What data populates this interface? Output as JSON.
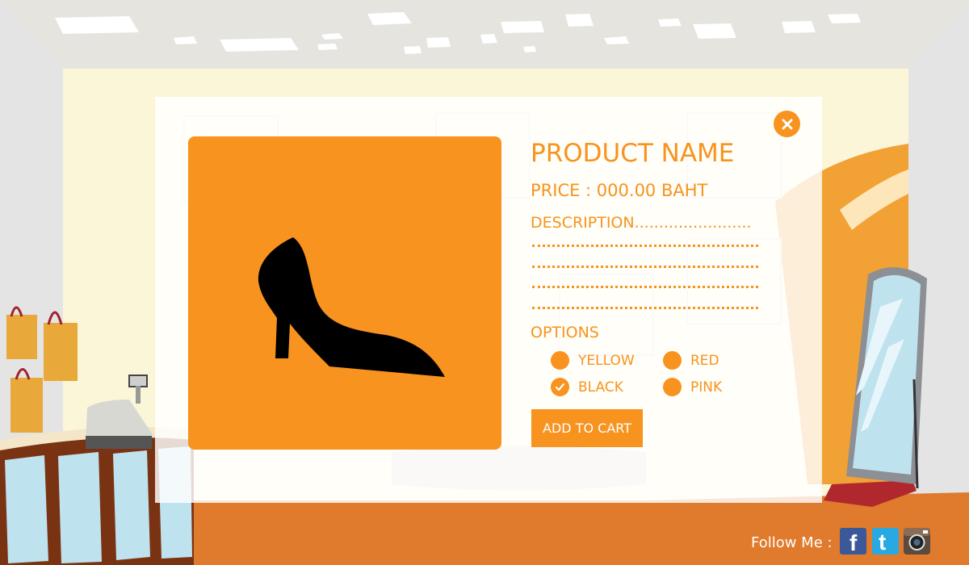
{
  "product": {
    "name": "PRODUCT NAME",
    "price": "PRICE :  000.00 BAHT",
    "description_label": "DESCRIPTION........................",
    "image_icon": "high-heel-shoe-icon"
  },
  "options": {
    "label": "OPTIONS",
    "items": [
      {
        "label": "YELLOW",
        "checked": false
      },
      {
        "label": "RED",
        "checked": false
      },
      {
        "label": "BLACK",
        "checked": true
      },
      {
        "label": "PINK",
        "checked": false
      }
    ]
  },
  "add_to_cart_label": "ADD TO CART",
  "close_icon": "close-icon",
  "footer": {
    "follow_label": "Follow Me :",
    "social": [
      {
        "name": "facebook-icon",
        "color": "#3b5998",
        "glyph": "f"
      },
      {
        "name": "twitter-icon",
        "color": "#29a9e1",
        "glyph": "t"
      },
      {
        "name": "instagram-icon",
        "color": "#5b4a3f",
        "glyph": ""
      }
    ]
  },
  "colors": {
    "accent": "#f7931e",
    "floor": "#e07a2c",
    "wall": "#fbf6d8",
    "ceiling": "#e6e3dc"
  }
}
